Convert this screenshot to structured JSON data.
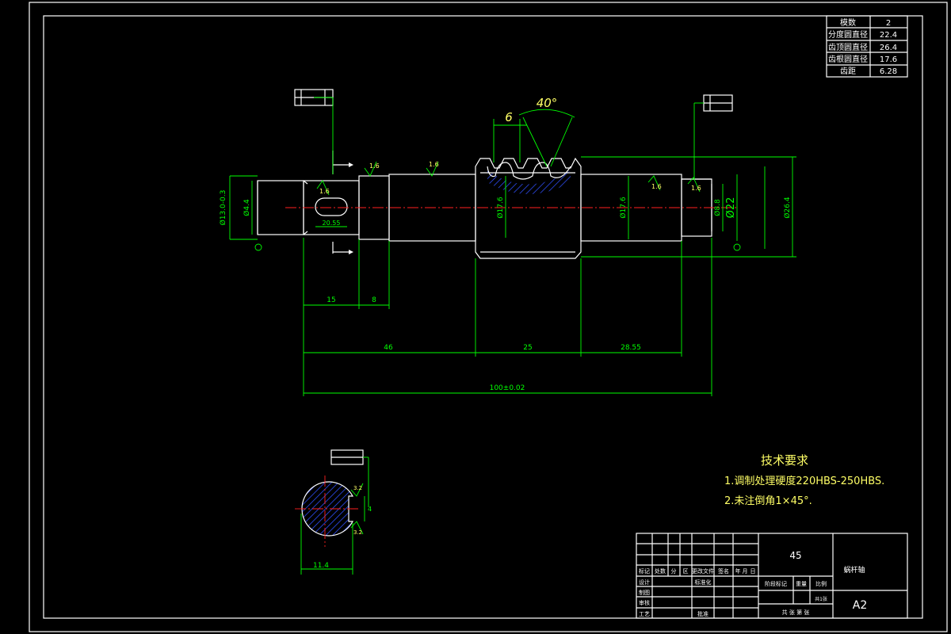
{
  "param_table": [
    {
      "label": "模数",
      "value": "2"
    },
    {
      "label": "分度圆直径",
      "value": "22.4"
    },
    {
      "label": "齿顶圆直径",
      "value": "26.4"
    },
    {
      "label": "齿根圆直径",
      "value": "17.6"
    },
    {
      "label": "齿距",
      "value": "6.28"
    }
  ],
  "dimensions": {
    "tooth_pitch": "6",
    "tooth_angle": "40°",
    "left_dia": "Ø13.0-0.3",
    "keyway_dia": "Ø4.4",
    "keyway_len": "20.55",
    "gear_root": "Ø17.6",
    "mid_dia": "Ø17.6",
    "right_dia": "Ø8.8",
    "outer_22": "Ø22",
    "outer_26": "Ø26.4",
    "len_15": "15",
    "len_8": "8",
    "len_46": "46",
    "len_25": "25",
    "len_28": "28.55",
    "total_len": "100±0.02",
    "section_width": "11.4",
    "section_key": "4",
    "rough_1": "1.6",
    "rough_2": "1.6",
    "rough_3": "1.6",
    "rough_4": "1.6",
    "rough_5": "1.6",
    "rough_6": "1.6",
    "rough_s1": "3.2",
    "rough_s2": "3.2"
  },
  "tech_req": {
    "title": "技术要求",
    "line1": "1.调制处理硬度220HBS-250HBS.",
    "line2": "2.未注倒角1×45°."
  },
  "title_block": {
    "material": "45",
    "part_name": "蜗杆轴",
    "sheet_size": "A2",
    "row_labels": [
      "标记",
      "处数",
      "分",
      "区",
      "更改文件",
      "签名",
      "年",
      "月",
      "日"
    ],
    "design": "设计",
    "standardize": "标准化",
    "drafting": "制图",
    "check": "审核",
    "process": "工艺",
    "approve": "批准",
    "stage_mark": "阶段标记",
    "weight": "重量",
    "scale": "比例",
    "sheets": "共 张 第 张",
    "sheet_count": "共1张"
  }
}
